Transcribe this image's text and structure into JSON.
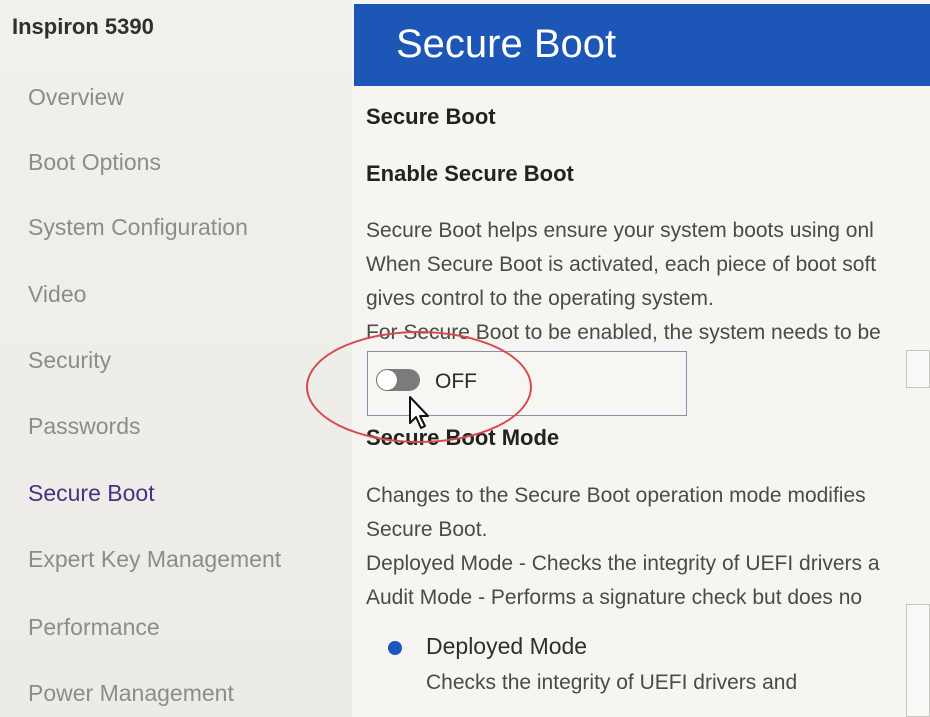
{
  "sidebar": {
    "device_title": "Inspiron 5390",
    "items": [
      {
        "label": "Overview"
      },
      {
        "label": "Boot Options"
      },
      {
        "label": "System Configuration"
      },
      {
        "label": "Video"
      },
      {
        "label": "Security"
      },
      {
        "label": "Passwords"
      },
      {
        "label": "Secure Boot",
        "active": true
      },
      {
        "label": "Expert Key Management"
      },
      {
        "label": "Performance"
      },
      {
        "label": "Power Management"
      }
    ]
  },
  "header": {
    "title": "Secure Boot"
  },
  "colors": {
    "header_bg": "#1c56b7",
    "active_nav": "#4b2f84",
    "annotation": "#d8484c"
  },
  "section": {
    "title": "Secure Boot",
    "enable": {
      "title": "Enable Secure Boot",
      "description": [
        "Secure Boot helps ensure your system boots using onl",
        " When Secure Boot is activated, each piece of boot soft",
        "gives control to the operating system.",
        " For Secure Boot to be enabled, the system needs to be"
      ],
      "toggle": {
        "state_label": "OFF",
        "value": false
      }
    },
    "mode": {
      "title": "Secure Boot Mode",
      "description": [
        "Changes to the Secure Boot operation mode modifies",
        "Secure Boot.",
        " Deployed Mode - Checks the integrity of UEFI drivers a",
        " Audit Mode - Performs a signature check but does no"
      ],
      "options": [
        {
          "label": "Deployed Mode",
          "selected": true,
          "description": "Checks the integrity of UEFI drivers and"
        }
      ]
    }
  },
  "icons": {
    "toggle": "toggle-switch-icon",
    "cursor": "mouse-pointer-icon",
    "radio": "radio-selected-icon"
  }
}
